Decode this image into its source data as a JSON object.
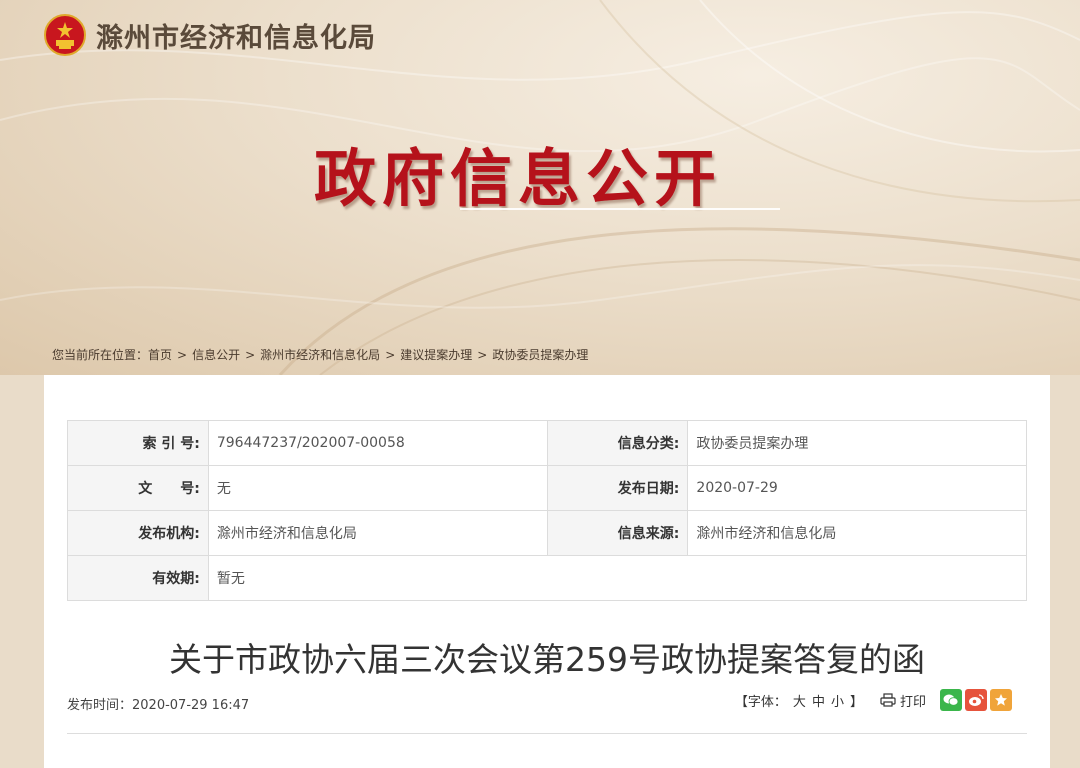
{
  "header": {
    "site_name": "滁州市经济和信息化局",
    "hero_title": "政府信息公开"
  },
  "breadcrumb": {
    "prefix": "您当前所在位置：",
    "items": [
      "首页",
      "信息公开",
      "滁州市经济和信息化局",
      "建议提案办理",
      "政协委员提案办理"
    ],
    "separator": ">"
  },
  "meta": {
    "rows": [
      {
        "k1": "索 引 号:",
        "v1": "796447237/202007-00058",
        "k2": "信息分类:",
        "v2": "政协委员提案办理"
      },
      {
        "k1": "文　　号:",
        "v1": "无",
        "k2": "发布日期:",
        "v2": "2020-07-29"
      },
      {
        "k1": "发布机构:",
        "v1": "滁州市经济和信息化局",
        "k2": "信息来源:",
        "v2": "滁州市经济和信息化局"
      },
      {
        "k1": "有效期:",
        "v1": "暂无"
      }
    ]
  },
  "article": {
    "title": "关于市政协六届三次会议第259号政协提案答复的函",
    "pub_time": "发布时间：2020-07-29 16:47"
  },
  "tools": {
    "font_prefix": "【字体：",
    "font_large": "大",
    "font_medium": "中",
    "font_small": "小",
    "font_suffix": "】",
    "print": "打印"
  },
  "colors": {
    "hero_red": "#b5121b",
    "wechat": "#3bb64b",
    "weibo": "#e6533c",
    "favorite": "#f0a43a"
  }
}
